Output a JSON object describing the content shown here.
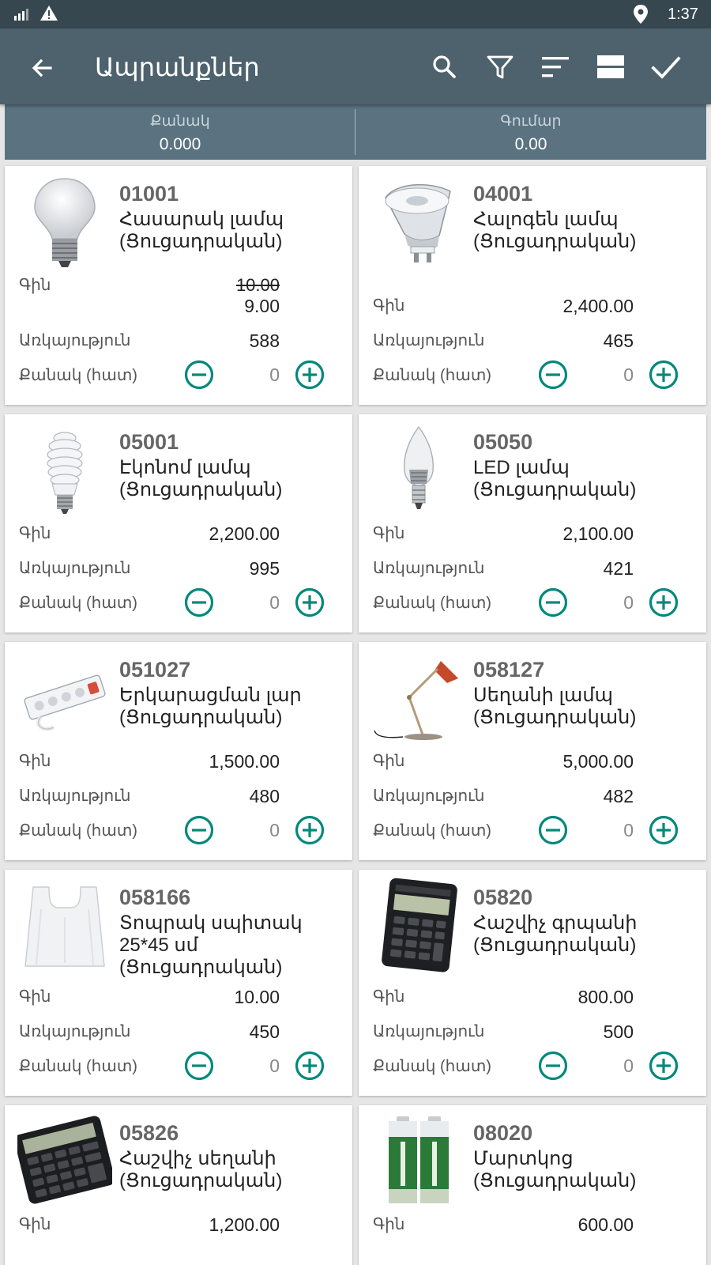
{
  "status_bar": {
    "time": "1:37",
    "icons": [
      "signal-icon",
      "warning-icon",
      "location-pin-icon"
    ]
  },
  "app_bar": {
    "title": "Ապրանքներ",
    "actions": [
      "search-icon",
      "filter-icon",
      "sort-icon",
      "view-toggle-icon",
      "check-icon"
    ]
  },
  "totals": {
    "quantity_label": "Քանակ",
    "quantity_value": "0.000",
    "sum_label": "Գումար",
    "sum_value": "0.00"
  },
  "labels": {
    "price": "Գին",
    "availability": "Առկայություն",
    "quantity": "Քանակ (հատ)"
  },
  "products": [
    {
      "code": "01001",
      "name": "Հասարակ լամպ (Ցուցադրական)",
      "old_price": "10.00",
      "price": "9.00",
      "stock": "588",
      "qty": "0",
      "image": "incandescent-bulb-image"
    },
    {
      "code": "04001",
      "name": "Հալոգեն լամպ (Ցուցադրական)",
      "old_price": "",
      "price": "2,400.00",
      "stock": "465",
      "qty": "0",
      "image": "halogen-bulb-image"
    },
    {
      "code": "05001",
      "name": "Էկոնոմ լամպ (Ցուցադրական)",
      "old_price": "",
      "price": "2,200.00",
      "stock": "995",
      "qty": "0",
      "image": "spiral-bulb-image"
    },
    {
      "code": "05050",
      "name": "LED լամպ (Ցուցադրական)",
      "old_price": "",
      "price": "2,100.00",
      "stock": "421",
      "qty": "0",
      "image": "led-candle-bulb-image"
    },
    {
      "code": "051027",
      "name": "Երկարացման լար (Ցուցադրական)",
      "old_price": "",
      "price": "1,500.00",
      "stock": "480",
      "qty": "0",
      "image": "extension-cord-image"
    },
    {
      "code": "058127",
      "name": "Սեղանի լամպ (Ցուցադրական)",
      "old_price": "",
      "price": "5,000.00",
      "stock": "482",
      "qty": "0",
      "image": "desk-lamp-image"
    },
    {
      "code": "058166",
      "name": "Տոպրակ սպիտակ 25*45 սմ (Ցուցադրական)",
      "old_price": "",
      "price": "10.00",
      "stock": "450",
      "qty": "0",
      "image": "plastic-bag-image"
    },
    {
      "code": "05820",
      "name": "Հաշվիչ գրպանի (Ցուցադրական)",
      "old_price": "",
      "price": "800.00",
      "stock": "500",
      "qty": "0",
      "image": "pocket-calculator-image"
    },
    {
      "code": "05826",
      "name": "Հաշվիչ սեղանի (Ցուցադրական)",
      "old_price": "",
      "price": "1,200.00",
      "stock": "",
      "qty": "",
      "image": "desk-calculator-image"
    },
    {
      "code": "08020",
      "name": "Մարտկոց (Ցուցադրական)",
      "old_price": "",
      "price": "600.00",
      "stock": "",
      "qty": "",
      "image": "battery-image"
    }
  ],
  "colors": {
    "app_bar": "#4e626d",
    "status_bar": "#37474f",
    "totals_bar": "#5b7380",
    "accent": "#00897b"
  }
}
